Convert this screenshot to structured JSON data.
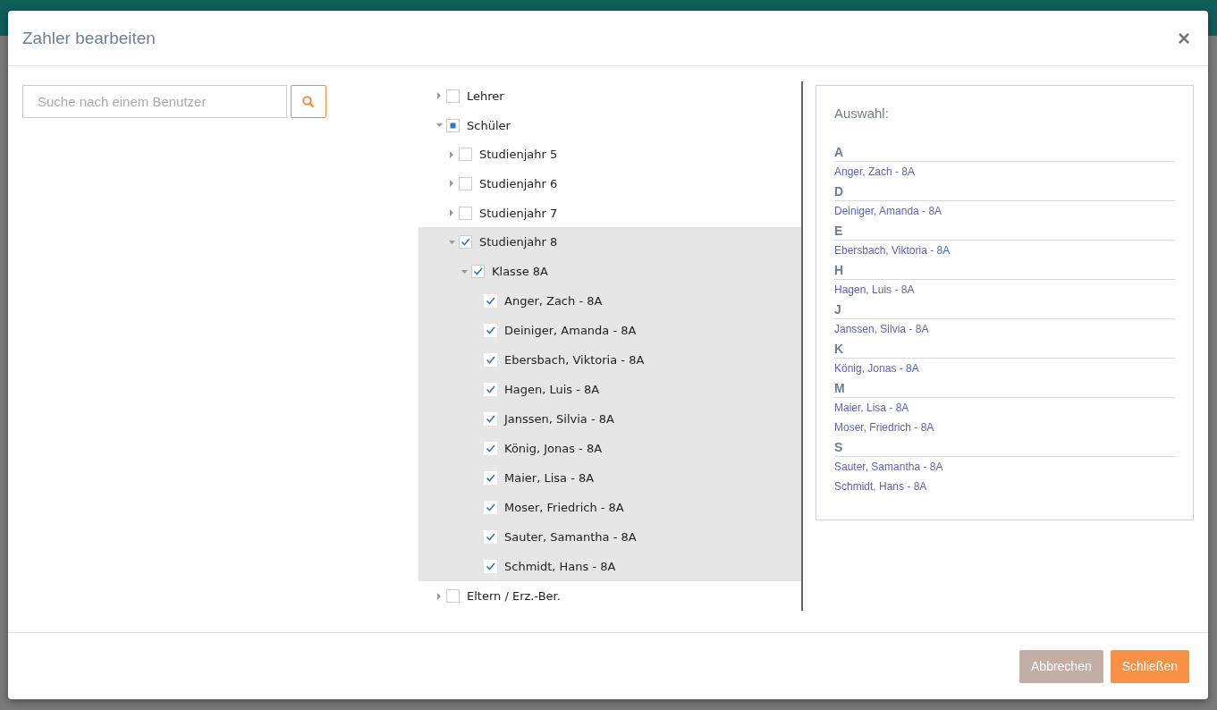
{
  "dialog": {
    "title": "Zahler bearbeiten",
    "close": "×"
  },
  "search": {
    "placeholder": "Suche nach einem Benutzer"
  },
  "tree": [
    {
      "label": "Lehrer",
      "checked": false,
      "indeterminate": false,
      "expanded": false,
      "selected": false
    },
    {
      "label": "Schüler",
      "checked": false,
      "indeterminate": true,
      "expanded": true,
      "selected": false,
      "children": [
        {
          "label": "Studienjahr 5",
          "checked": false,
          "indeterminate": false,
          "expanded": false,
          "selected": false
        },
        {
          "label": "Studienjahr 6",
          "checked": false,
          "indeterminate": false,
          "expanded": false,
          "selected": false
        },
        {
          "label": "Studienjahr 7",
          "checked": false,
          "indeterminate": false,
          "expanded": false,
          "selected": false
        },
        {
          "label": "Studienjahr 8",
          "checked": true,
          "indeterminate": false,
          "expanded": true,
          "selected": true,
          "children": [
            {
              "label": "Klasse 8A",
              "checked": true,
              "indeterminate": false,
              "expanded": true,
              "children": [
                {
                  "label": "Anger, Zach - 8A",
                  "checked": true,
                  "indeterminate": false
                },
                {
                  "label": "Deiniger, Amanda - 8A",
                  "checked": true,
                  "indeterminate": false
                },
                {
                  "label": "Ebersbach, Viktoria - 8A",
                  "checked": true,
                  "indeterminate": false
                },
                {
                  "label": "Hagen, Luis - 8A",
                  "checked": true,
                  "indeterminate": false
                },
                {
                  "label": "Janssen, Silvia - 8A",
                  "checked": true,
                  "indeterminate": false
                },
                {
                  "label": "König, Jonas - 8A",
                  "checked": true,
                  "indeterminate": false
                },
                {
                  "label": "Maier, Lisa - 8A",
                  "checked": true,
                  "indeterminate": false
                },
                {
                  "label": "Moser, Friedrich - 8A",
                  "checked": true,
                  "indeterminate": false
                },
                {
                  "label": "Sauter, Samantha - 8A",
                  "checked": true,
                  "indeterminate": false
                },
                {
                  "label": "Schmidt, Hans - 8A",
                  "checked": true,
                  "indeterminate": false
                }
              ]
            }
          ]
        }
      ]
    },
    {
      "label": "Eltern / Erz.-Ber.",
      "checked": false,
      "indeterminate": false,
      "expanded": false,
      "selected": false
    }
  ],
  "selection": {
    "title": "Auswahl:",
    "groups": [
      {
        "letter": "A",
        "names": [
          "Anger, Zach - 8A"
        ]
      },
      {
        "letter": "D",
        "names": [
          "Deiniger, Amanda - 8A"
        ]
      },
      {
        "letter": "E",
        "names": [
          "Ebersbach, Viktoria - 8A"
        ]
      },
      {
        "letter": "H",
        "names": [
          "Hagen, Luis - 8A"
        ]
      },
      {
        "letter": "J",
        "names": [
          "Janssen, Silvia - 8A"
        ]
      },
      {
        "letter": "K",
        "names": [
          "König, Jonas - 8A"
        ]
      },
      {
        "letter": "M",
        "names": [
          "Maier, Lisa - 8A",
          "Moser, Friedrich - 8A"
        ]
      },
      {
        "letter": "S",
        "names": [
          "Sauter, Samantha - 8A",
          "Schmidt, Hans - 8A"
        ]
      }
    ]
  },
  "buttons": [
    {
      "label": "Abbrechen",
      "kind": "secondary"
    },
    {
      "label": "Schließen",
      "kind": "primary"
    }
  ]
}
